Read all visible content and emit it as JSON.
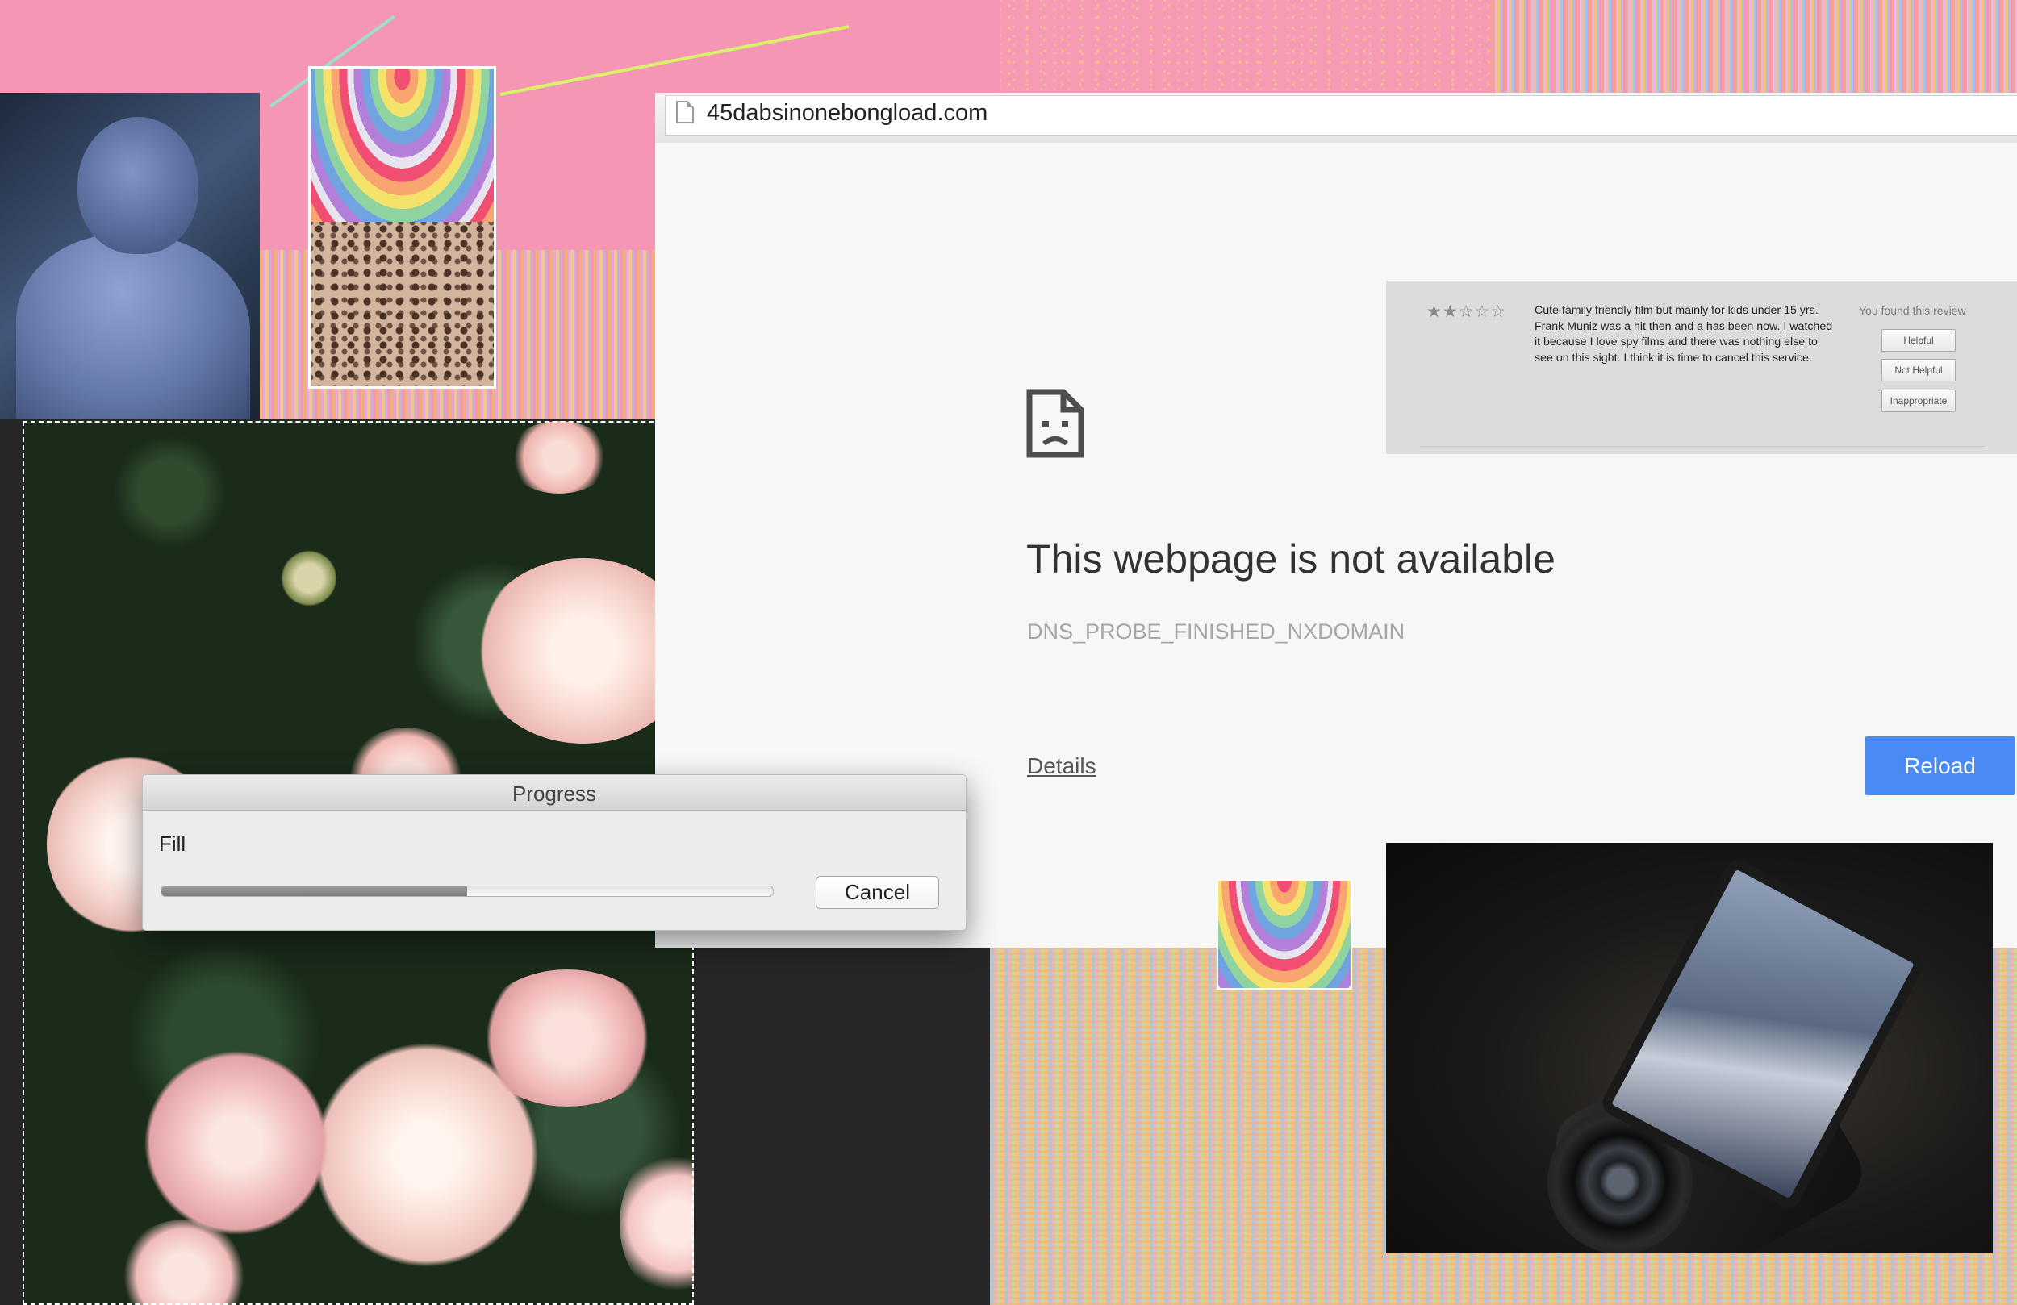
{
  "browser": {
    "url": "45dabsinonebongload.com"
  },
  "error_page": {
    "icon": "sad-page-icon",
    "title": "This webpage is not available",
    "error_code": "DNS_PROBE_FINISHED_NXDOMAIN",
    "details_label": "Details",
    "reload_label": "Reload"
  },
  "review": {
    "rating": 2,
    "max_rating": 5,
    "stars_display": "★★☆☆☆",
    "text": "Cute family friendly film but mainly for kids under 15 yrs. Frank Muniz was a hit then and a has been now. I watched it because I love spy films and there was nothing else to see on this sight. I think it is time to cancel this service.",
    "found_prompt": "You found this review",
    "buttons": [
      "Helpful",
      "Not Helpful",
      "Inappropriate"
    ]
  },
  "dialog": {
    "title": "Progress",
    "task_label": "Fill",
    "progress_fraction": 0.5,
    "cancel_label": "Cancel"
  },
  "colors": {
    "background_pink": "#f596b4",
    "reload_blue": "#4a8af4",
    "canvas_dark": "#262626"
  }
}
